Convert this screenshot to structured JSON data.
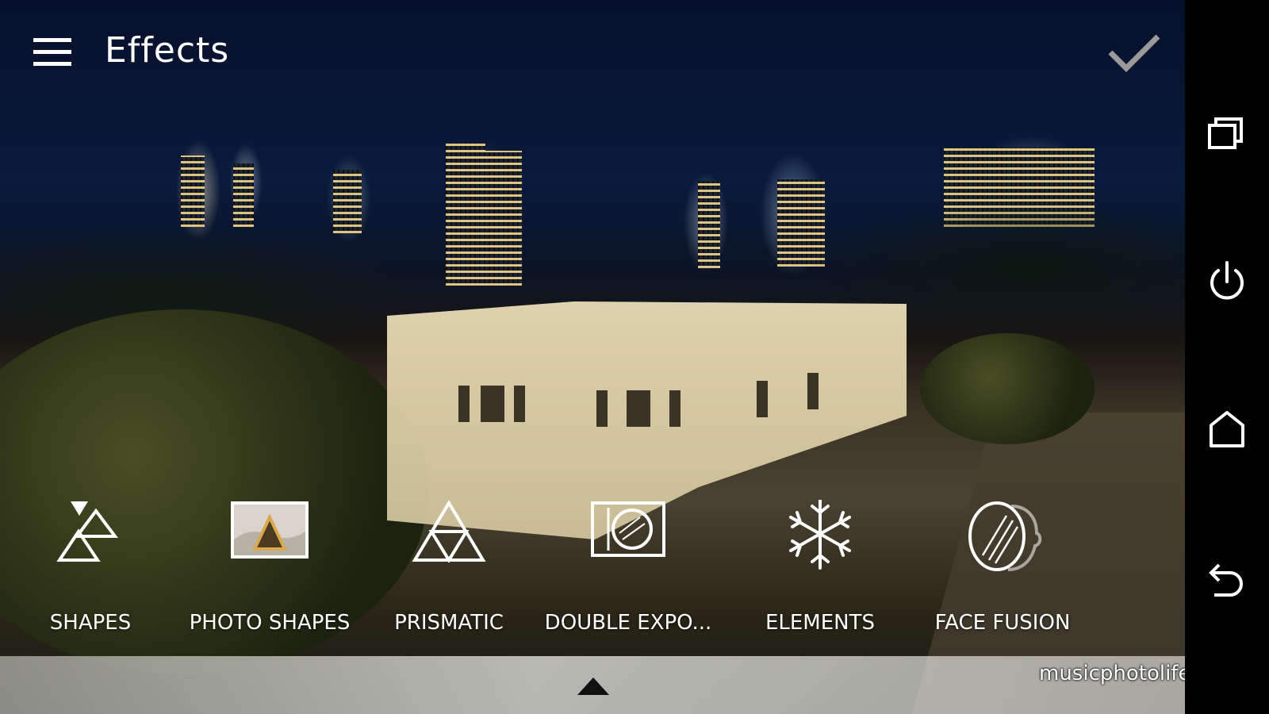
{
  "app_bar": {
    "title": "Effects",
    "menu_icon": "hamburger-menu-icon",
    "confirm_icon": "checkmark-icon"
  },
  "effects": [
    {
      "label": "SHAPES",
      "icon": "shapes-icon"
    },
    {
      "label": "PHOTO SHAPES",
      "icon": "photo-shapes-icon"
    },
    {
      "label": "PRISMATIC",
      "icon": "prismatic-icon"
    },
    {
      "label": "DOUBLE EXPO...",
      "icon": "double-exposure-icon"
    },
    {
      "label": "ELEMENTS",
      "icon": "snowflake-icon"
    },
    {
      "label": "FACE FUSION",
      "icon": "face-fusion-icon"
    }
  ],
  "panel": {
    "expand_icon": "triangle-up-icon"
  },
  "watermark": "musicphotolife.com",
  "nav_bar": {
    "buttons": [
      {
        "icon": "recent-apps-icon"
      },
      {
        "icon": "power-icon"
      },
      {
        "icon": "home-icon"
      },
      {
        "icon": "back-icon"
      }
    ]
  },
  "colors": {
    "foreground": "#ffffff",
    "confirm_disabled": "#9a9a9a",
    "nav_bar_bg": "#000000"
  }
}
